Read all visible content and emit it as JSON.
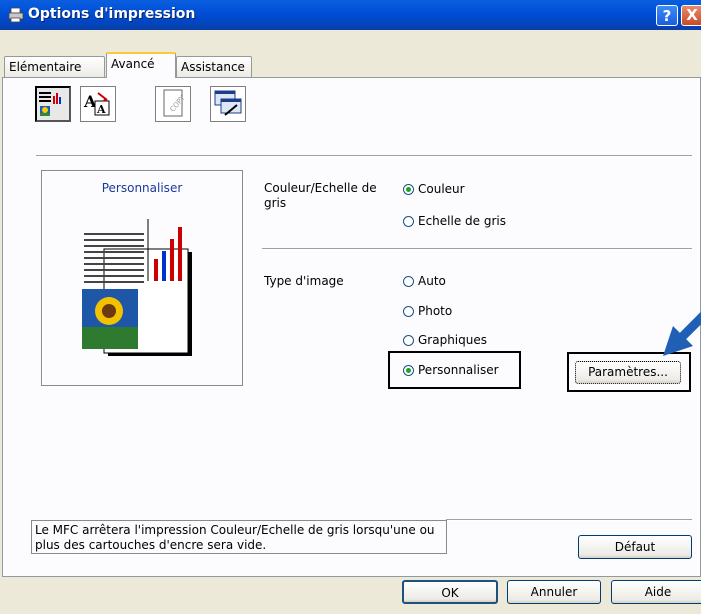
{
  "window": {
    "title": "Options d'impression",
    "help_label": "?",
    "close_label": "X"
  },
  "tabs": [
    {
      "label": "Elémentaire",
      "active": false
    },
    {
      "label": "Avancé",
      "active": true
    },
    {
      "label": "Assistance",
      "active": false
    }
  ],
  "toolbar": {
    "icons": [
      "color-settings-icon",
      "scaling-icon",
      "watermark-icon",
      "device-options-icon"
    ]
  },
  "preview": {
    "label": "Personnaliser"
  },
  "color": {
    "label": "Couleur/Echelle de gris",
    "options": [
      "Couleur",
      "Echelle de gris"
    ],
    "selected": "Couleur"
  },
  "image_type": {
    "label": "Type d'image",
    "options": [
      "Auto",
      "Photo",
      "Graphiques",
      "Personnaliser"
    ],
    "selected": "Personnaliser",
    "settings_button": "Paramètres..."
  },
  "status_message": "Le MFC arrêtera l'impression Couleur/Echelle de gris lorsqu'une ou plus des cartouches d'encre sera vide.",
  "buttons": {
    "default": "Défaut",
    "ok": "OK",
    "cancel": "Annuler",
    "help": "Aide"
  },
  "colors": {
    "titlebar": "#0050d8",
    "accent_arrow": "#1f5fb5",
    "radio_dot": "#21a121"
  }
}
